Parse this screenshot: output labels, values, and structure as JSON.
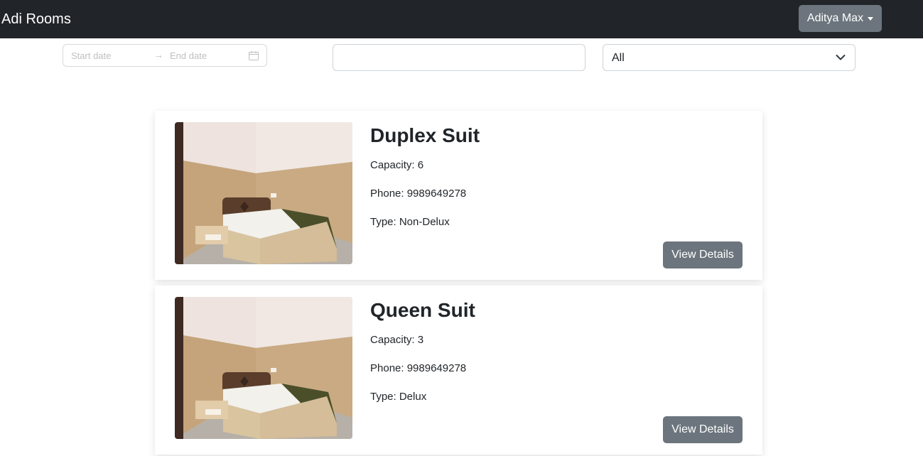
{
  "navbar": {
    "brand": "Adi Rooms",
    "user_menu_label": "Aditya Max"
  },
  "filters": {
    "date_start_placeholder": "Start date",
    "date_arrow": "→",
    "date_end_placeholder": "End date",
    "search_value": "",
    "type_select_value": "All"
  },
  "rooms": [
    {
      "name": "Duplex Suit",
      "capacity": "Capacity: 6",
      "phone": "Phone: 9989649278",
      "type": "Type: Non-Delux",
      "button_label": "View Details"
    },
    {
      "name": "Queen Suit",
      "capacity": "Capacity: 3",
      "phone": "Phone: 9989649278",
      "type": "Type: Delux",
      "button_label": "View Details"
    }
  ],
  "colors": {
    "navbar_bg": "#212529",
    "secondary_button": "#6c757d"
  }
}
